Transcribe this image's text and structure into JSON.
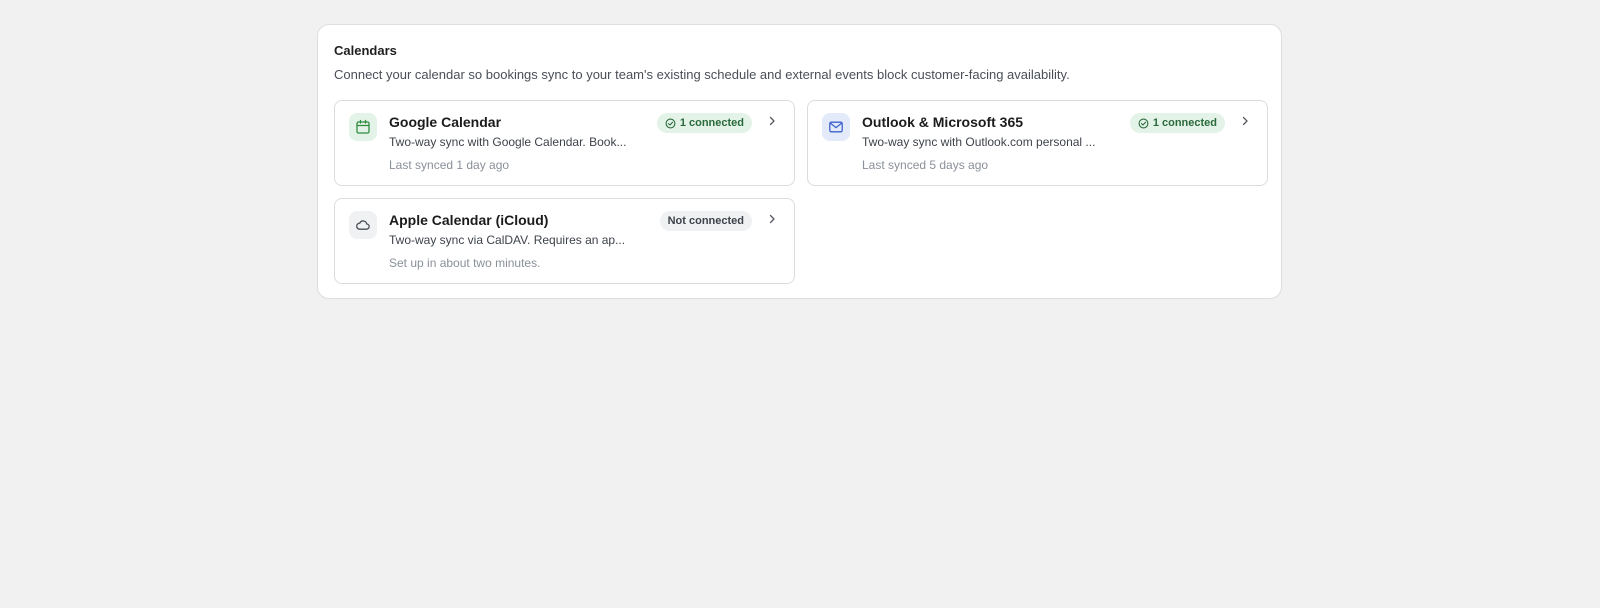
{
  "panel": {
    "title": "Calendars",
    "description": "Connect your calendar so bookings sync to your team's existing schedule and external events block customer-facing availability."
  },
  "cards": [
    {
      "name": "Google Calendar",
      "description": "Two-way sync with Google Calendar. Book...",
      "sub": "Last synced 1 day ago",
      "status": "1 connected",
      "icon": "calendar-icon",
      "icon_color": "#2e8b3e",
      "icon_bg": "#e4f3e8"
    },
    {
      "name": "Outlook & Microsoft 365",
      "description": "Two-way sync with Outlook.com personal ...",
      "sub": "Last synced 5 days ago",
      "status": "1 connected",
      "icon": "mail-icon",
      "icon_color": "#3e63c9",
      "icon_bg": "#e3eafa"
    },
    {
      "name": "Apple Calendar (iCloud)",
      "description": "Two-way sync via CalDAV. Requires an ap...",
      "sub": "Set up in about two minutes.",
      "status": "Not connected",
      "icon": "cloud-icon",
      "icon_color": "#4a4f57",
      "icon_bg": "#f0f1f3"
    }
  ],
  "colors": {
    "connected_bg": "#e4f3e8",
    "connected_text": "#2b6a3c",
    "disconnected_bg": "#f0f1f3",
    "disconnected_text": "#3d434b"
  }
}
